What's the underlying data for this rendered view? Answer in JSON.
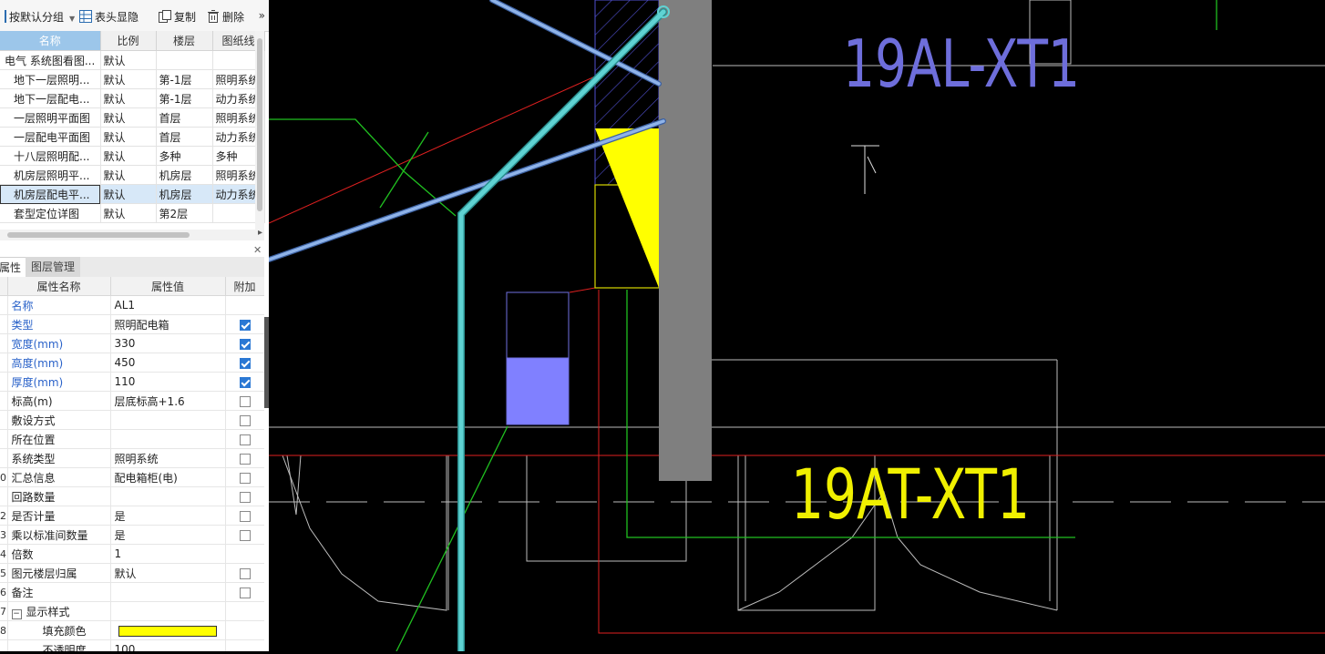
{
  "toolbar": {
    "group_label": "按默认分组",
    "header_toggle_label": "表头显隐",
    "copy_label": "复制",
    "delete_label": "删除"
  },
  "drawing_list": {
    "columns": [
      "名称",
      "比例",
      "楼层",
      "图纸线"
    ],
    "rows": [
      {
        "name": "电气 系统图看图...",
        "scale": "默认",
        "floor": "",
        "type": ""
      },
      {
        "name": "地下一层照明...",
        "scale": "默认",
        "floor": "第-1层",
        "type": "照明系统"
      },
      {
        "name": "地下一层配电...",
        "scale": "默认",
        "floor": "第-1层",
        "type": "动力系统"
      },
      {
        "name": "一层照明平面图",
        "scale": "默认",
        "floor": "首层",
        "type": "照明系统"
      },
      {
        "name": "一层配电平面图",
        "scale": "默认",
        "floor": "首层",
        "type": "动力系统"
      },
      {
        "name": "十八层照明配...",
        "scale": "默认",
        "floor": "多种",
        "type": "多种"
      },
      {
        "name": "机房层照明平...",
        "scale": "默认",
        "floor": "机房层",
        "type": "照明系统"
      },
      {
        "name": "机房层配电平...",
        "scale": "默认",
        "floor": "机房层",
        "type": "动力系统"
      },
      {
        "name": "套型定位详图",
        "scale": "默认",
        "floor": "第2层",
        "type": ""
      }
    ]
  },
  "panel_tabs": {
    "properties": "属性",
    "layers": "图层管理"
  },
  "properties": {
    "columns": [
      "属性名称",
      "属性值",
      "附加"
    ],
    "rows": [
      {
        "num": "",
        "name": "名称",
        "value": "AL1",
        "blue": true,
        "check": null
      },
      {
        "num": "",
        "name": "类型",
        "value": "照明配电箱",
        "blue": true,
        "check": true
      },
      {
        "num": "",
        "name": "宽度(mm)",
        "value": "330",
        "blue": true,
        "check": true
      },
      {
        "num": "",
        "name": "高度(mm)",
        "value": "450",
        "blue": true,
        "check": true
      },
      {
        "num": "",
        "name": "厚度(mm)",
        "value": "110",
        "blue": true,
        "check": true
      },
      {
        "num": "",
        "name": "标高(m)",
        "value": "层底标高+1.6",
        "blue": false,
        "check": false
      },
      {
        "num": "",
        "name": "敷设方式",
        "value": "",
        "blue": false,
        "check": false
      },
      {
        "num": "",
        "name": "所在位置",
        "value": "",
        "blue": false,
        "check": false
      },
      {
        "num": "",
        "name": "系统类型",
        "value": "照明系统",
        "blue": false,
        "check": false
      },
      {
        "num": "0",
        "name": "汇总信息",
        "value": "配电箱柜(电)",
        "blue": false,
        "check": false
      },
      {
        "num": "",
        "name": "回路数量",
        "value": "",
        "blue": false,
        "check": false
      },
      {
        "num": "2",
        "name": "是否计量",
        "value": "是",
        "blue": false,
        "check": false
      },
      {
        "num": "3",
        "name": "乘以标准间数量",
        "value": "是",
        "blue": false,
        "check": false
      },
      {
        "num": "4",
        "name": "倍数",
        "value": "1",
        "blue": false,
        "check": null
      },
      {
        "num": "5",
        "name": "图元楼层归属",
        "value": "默认",
        "blue": false,
        "check": false
      },
      {
        "num": "6",
        "name": "备注",
        "value": "",
        "blue": false,
        "check": false
      },
      {
        "num": "7",
        "name": "显示样式",
        "value": "",
        "blue": false,
        "check": null,
        "group": true
      },
      {
        "num": "8",
        "name": "填充颜色",
        "value": "",
        "blue": false,
        "check": null,
        "swatch": true,
        "indent": true
      },
      {
        "num": "",
        "name": "不透明度",
        "value": "100",
        "blue": false,
        "check": null,
        "indent": true
      }
    ],
    "fill_color": "#ffff00"
  },
  "canvas": {
    "label_top": "19AL-XT1",
    "label_bottom": "19AT-XT1",
    "label_down": "下",
    "colors": {
      "label_top": "#6e6edb",
      "label_bottom": "#f0f000",
      "pipe": "#5fd3d3",
      "pipe2": "#8fb3e8",
      "box": "#8080ff"
    }
  }
}
